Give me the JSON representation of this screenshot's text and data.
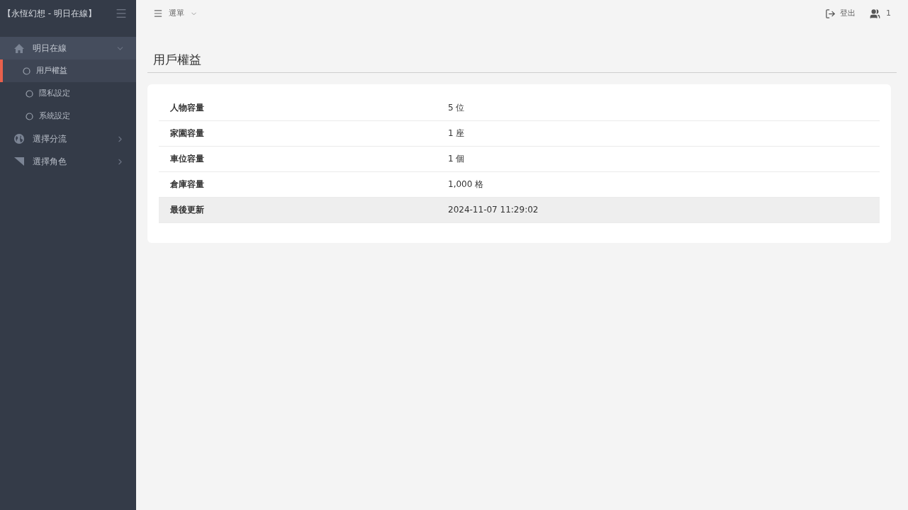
{
  "sidebar": {
    "title": "【永恆幻想 - 明日在線】",
    "items": [
      {
        "label": "明日在線",
        "kind": "home",
        "expanded": true,
        "selected": true,
        "children": [
          {
            "label": "用戶權益",
            "selected": true
          },
          {
            "label": "隱私設定",
            "selected": false
          },
          {
            "label": "系統設定",
            "selected": false
          }
        ]
      },
      {
        "label": "選擇分流",
        "kind": "globe",
        "expanded": false,
        "selected": false
      },
      {
        "label": "選擇角色",
        "kind": "pennant",
        "expanded": false,
        "selected": false
      }
    ]
  },
  "topbar": {
    "menu": "選單",
    "logout": "登出",
    "users": "1"
  },
  "page": {
    "title": "用戶權益",
    "rows": [
      {
        "label": "人物容量",
        "value": "5 位",
        "selected": false
      },
      {
        "label": "家園容量",
        "value": "1 座",
        "selected": false
      },
      {
        "label": "車位容量",
        "value": "1 個",
        "selected": false
      },
      {
        "label": "倉庫容量",
        "value": "1,000 格",
        "selected": false
      },
      {
        "label": "最後更新",
        "value": "2024-11-07 11:29:02",
        "selected": true
      }
    ]
  }
}
